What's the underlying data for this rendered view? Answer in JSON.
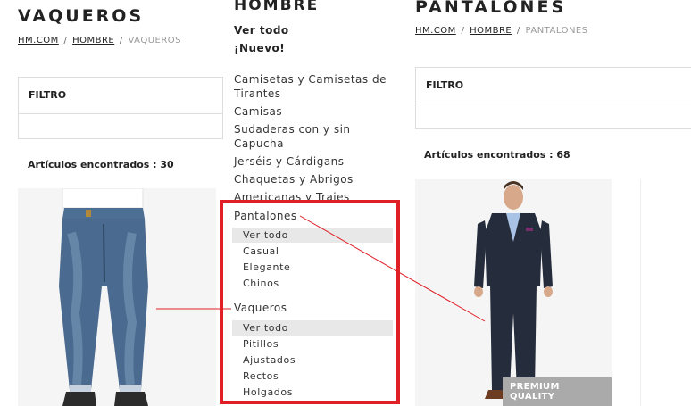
{
  "left_page": {
    "title": "VAQUEROS",
    "breadcrumb": {
      "home": "HM.COM",
      "section": "HOMBRE",
      "current": "VAQUEROS",
      "separator": "/"
    },
    "filter_label": "FILTRO",
    "items_found": "Artículos encontrados : 30"
  },
  "right_page": {
    "title": "PANTALONES",
    "breadcrumb": {
      "home": "HM.COM",
      "section": "HOMBRE",
      "current": "PANTALONES",
      "separator": "/"
    },
    "filter_label": "FILTRO",
    "items_found": "Artículos encontrados : 68",
    "badge": "PREMIUM QUALITY"
  },
  "menu": {
    "heading": "HOMBRE",
    "see_all": "Ver todo",
    "new": "¡Nuevo!",
    "items": [
      "Camisetas y Camisetas de Tirantes",
      "Camisas",
      "Sudaderas con y sin Capucha",
      "Jerséis y Cárdigans",
      "Chaquetas y Abrigos",
      "Americanas y Trajes"
    ],
    "pantalones": {
      "label": "Pantalones",
      "subitems": [
        "Ver todo",
        "Casual",
        "Elegante",
        "Chinos"
      ]
    },
    "vaqueros": {
      "label": "Vaqueros",
      "subitems": [
        "Ver todo",
        "Pitillos",
        "Ajustados",
        "Rectos",
        "Holgados"
      ]
    }
  },
  "colors": {
    "highlight": "#e01e26",
    "active_bg": "#e8e8e8",
    "jeans": "#4a6a8f",
    "suit": "#252c3b"
  },
  "icons": {
    "jeans_image": "jeans-product-photo",
    "suit_image": "suit-product-photo"
  }
}
